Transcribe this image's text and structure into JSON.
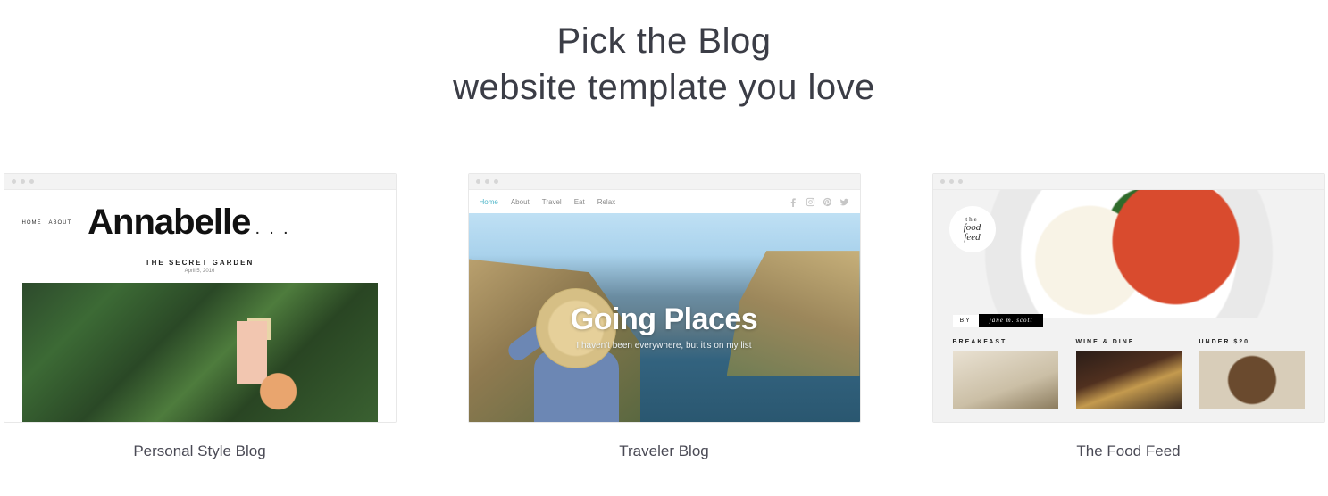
{
  "heading_line1": "Pick the Blog",
  "heading_line2": "website template you love",
  "templates": [
    {
      "caption": "Personal Style Blog",
      "nav": [
        "HOME",
        "ABOUT"
      ],
      "logo": "Annabelle",
      "post_title": "THE SECRET GARDEN",
      "post_date": "April 5, 2016"
    },
    {
      "caption": "Traveler Blog",
      "nav": [
        "Home",
        "About",
        "Travel",
        "Eat",
        "Relax"
      ],
      "hero_title": "Going Places",
      "hero_tagline": "I haven't been everywhere, but it's on my list"
    },
    {
      "caption": "The Food Feed",
      "badge_line1": "the",
      "badge_line2": "food",
      "badge_line3": "feed",
      "by_label": "BY",
      "author": "jane m. scott",
      "categories": [
        "BREAKFAST",
        "WINE & DINE",
        "UNDER $20"
      ]
    }
  ]
}
